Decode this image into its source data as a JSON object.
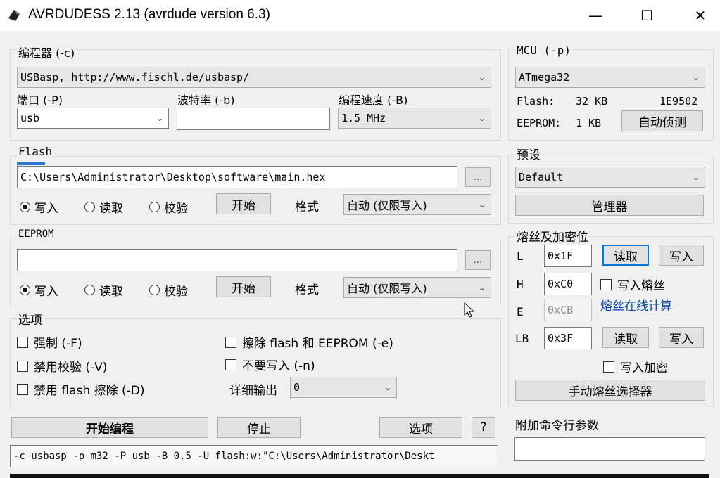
{
  "window": {
    "title": "AVRDUDESS 2.13 (avrdude version 6.3)",
    "minimize": "—",
    "maximize": "☐",
    "close": "✕"
  },
  "programmer": {
    "group_label": "编程器 (-c)",
    "value": "USBasp, http://www.fischl.de/usbasp/",
    "port_label": "端口 (-P)",
    "port_value": "usb",
    "baud_label": "波特率 (-b)",
    "baud_value": "",
    "bitclock_label": "编程速度 (-B)",
    "bitclock_value": "1.5 MHz"
  },
  "mcu": {
    "group_label": "MCU (-p)",
    "value": "ATmega32",
    "flash_label": "Flash:",
    "flash_size": "32 KB",
    "signature": "1E9502",
    "eeprom_label": "EEPROM:",
    "eeprom_size": "1 KB",
    "detect_button": "自动侦测"
  },
  "flash": {
    "group_label": "Flash",
    "path": "C:\\Users\\Administrator\\Desktop\\software\\main.hex",
    "browse": "...",
    "write": "写入",
    "read": "读取",
    "verify": "校验",
    "go": "开始",
    "format_label": "格式",
    "format_value": "自动 (仅限写入)"
  },
  "eeprom": {
    "group_label": "EEPROM",
    "path": "",
    "browse": "...",
    "write": "写入",
    "read": "读取",
    "verify": "校验",
    "go": "开始",
    "format_label": "格式",
    "format_value": "自动 (仅限写入)"
  },
  "presets": {
    "group_label": "预设",
    "value": "Default",
    "manager_button": "管理器"
  },
  "fuses": {
    "group_label": "熔丝及加密位",
    "l_label": "L",
    "l_value": "0x1F",
    "h_label": "H",
    "h_value": "0xC0",
    "e_label": "E",
    "e_value": "0xCB",
    "lb_label": "LB",
    "lb_value": "0x3F",
    "read": "读取",
    "write": "写入",
    "write_fuses": "写入熔丝",
    "calc_link": "熔丝在线计算",
    "write_lock": "写入加密",
    "selector_button": "手动熔丝选择器"
  },
  "options": {
    "group_label": "选项",
    "force": "强制 (-F)",
    "disable_verify": "禁用校验 (-V)",
    "disable_flash_erase": "禁用 flash 擦除 (-D)",
    "erase": "擦除 flash 和 EEPROM (-e)",
    "no_write": "不要写入 (-n)",
    "verbosity_label": "详细输出",
    "verbosity_value": "0"
  },
  "actions": {
    "program": "开始编程",
    "stop": "停止",
    "options": "选项",
    "help": "?"
  },
  "additional": {
    "group_label": "附加命令行参数",
    "value": ""
  },
  "command_line": "-c usbasp -p m32 -P usb -B 0.5 -U flash:w:\"C:\\Users\\Administrator\\Deskt"
}
